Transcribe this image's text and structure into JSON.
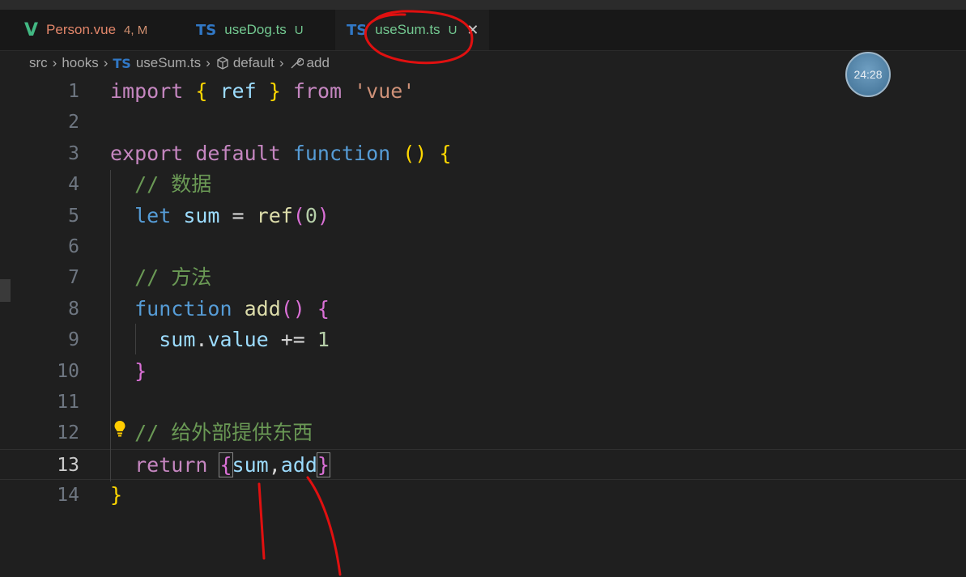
{
  "tabs": [
    {
      "icon": "vue-logo-icon",
      "name": "Person.vue",
      "status": "4, M",
      "color": "#e2866a",
      "status_color": "#d08f70"
    },
    {
      "icon": "ts-file-icon",
      "badge": "TS",
      "name": "useDog.ts",
      "status": "U",
      "color": "#73c991",
      "status_color": "#73c991"
    },
    {
      "icon": "ts-file-icon",
      "badge": "TS",
      "name": "useSum.ts",
      "status": "U",
      "color": "#73c991",
      "status_color": "#73c991",
      "active": true
    }
  ],
  "breadcrumb": {
    "parts": [
      "src",
      "hooks"
    ],
    "file_badge": "TS",
    "file": "useSum.ts",
    "symbol1": "default",
    "symbol2": "add"
  },
  "timer": "24:28",
  "editor": {
    "current_line": 13,
    "line_numbers": [
      "1",
      "2",
      "3",
      "4",
      "5",
      "6",
      "7",
      "8",
      "9",
      "10",
      "11",
      "12",
      "13",
      "14"
    ],
    "lines": [
      {
        "tokens": [
          [
            "import",
            "ctl"
          ],
          [
            " ",
            ""
          ],
          [
            "{",
            "b1"
          ],
          [
            " ",
            ""
          ],
          [
            "ref",
            "var"
          ],
          [
            " ",
            ""
          ],
          [
            "}",
            "b1"
          ],
          [
            " ",
            ""
          ],
          [
            "from",
            "ctl"
          ],
          [
            " ",
            ""
          ],
          [
            "'vue'",
            "str"
          ]
        ]
      },
      {
        "tokens": []
      },
      {
        "tokens": [
          [
            "export",
            "ctl"
          ],
          [
            " ",
            ""
          ],
          [
            "default",
            "ctl"
          ],
          [
            " ",
            ""
          ],
          [
            "function",
            "kw"
          ],
          [
            " ",
            ""
          ],
          [
            "()",
            "b1"
          ],
          [
            " ",
            ""
          ],
          [
            "{",
            "b1"
          ]
        ]
      },
      {
        "tokens": [
          [
            "  // 数据",
            "cmt"
          ]
        ]
      },
      {
        "tokens": [
          [
            "  ",
            ""
          ],
          [
            "let",
            "kw"
          ],
          [
            " ",
            ""
          ],
          [
            "sum",
            "var"
          ],
          [
            " = ",
            ""
          ],
          [
            "ref",
            "fn"
          ],
          [
            "(",
            "b2"
          ],
          [
            "0",
            "num"
          ],
          [
            ")",
            "b2"
          ]
        ]
      },
      {
        "tokens": []
      },
      {
        "tokens": [
          [
            "  // 方法",
            "cmt"
          ]
        ]
      },
      {
        "tokens": [
          [
            "  ",
            ""
          ],
          [
            "function",
            "kw"
          ],
          [
            " ",
            ""
          ],
          [
            "add",
            "fn"
          ],
          [
            "()",
            "b2"
          ],
          [
            " ",
            ""
          ],
          [
            "{",
            "b2"
          ]
        ]
      },
      {
        "tokens": [
          [
            "    ",
            ""
          ],
          [
            "sum",
            "var"
          ],
          [
            ".",
            ""
          ],
          [
            "value",
            "var"
          ],
          [
            " += ",
            ""
          ],
          [
            "1",
            "num"
          ]
        ]
      },
      {
        "tokens": [
          [
            "  ",
            ""
          ],
          [
            "}",
            "b2"
          ]
        ]
      },
      {
        "tokens": []
      },
      {
        "tokens": [
          [
            "  // 给外部提供东西",
            "cmt"
          ]
        ]
      },
      {
        "tokens": [
          [
            "  ",
            ""
          ],
          [
            "return",
            "ctl"
          ],
          [
            " ",
            ""
          ],
          [
            "{",
            "b2 match"
          ],
          [
            "sum",
            "var"
          ],
          [
            ",",
            ""
          ],
          [
            "add",
            "var"
          ],
          [
            "}",
            "b2 match"
          ]
        ]
      },
      {
        "tokens": [
          [
            "}",
            "b1"
          ]
        ]
      }
    ]
  },
  "colors": {
    "background": "#1f1f1f",
    "tabbar": "#181818",
    "annotation": "#e01010"
  }
}
